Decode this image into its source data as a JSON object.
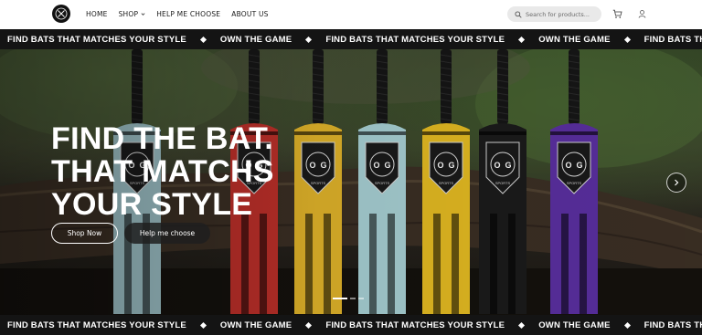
{
  "header": {
    "nav": [
      {
        "label": "HOME"
      },
      {
        "label": "SHOP",
        "has_dropdown": true
      },
      {
        "label": "HELP ME CHOOSE"
      },
      {
        "label": "ABOUT US"
      }
    ],
    "search_placeholder": "Search for products...",
    "icons": {
      "logo": "og-sports-logo",
      "search": "search-icon",
      "cart": "cart-icon",
      "account": "user-icon"
    }
  },
  "marquee": {
    "items": [
      "FIND BATS THAT MATCHES YOUR STYLE",
      "OWN THE GAME",
      "FIND BATS THAT MATCHES YOUR STYLE",
      "OWN THE GAME",
      "FIND BATS THAT MATCHES YOUR STYLE"
    ]
  },
  "hero": {
    "title_lines": [
      "FIND THE BAT.",
      "THAT MATCHS",
      "YOUR STYLE"
    ],
    "primary_button": "Shop Now",
    "secondary_button": "Help me choose",
    "bat_label": "SPORTS",
    "bat_letters": [
      "O",
      "G"
    ],
    "bat_colors": [
      "#9fc3c9",
      "#c0302a",
      "#e3b52a",
      "#a9d2d6",
      "#e6bc22",
      "#1b1b1b",
      "#5a2fa0"
    ],
    "slides_total": 3,
    "active_slide": 1
  },
  "colors": {
    "accent": "#141414",
    "search_bg": "#e9e9e9"
  }
}
